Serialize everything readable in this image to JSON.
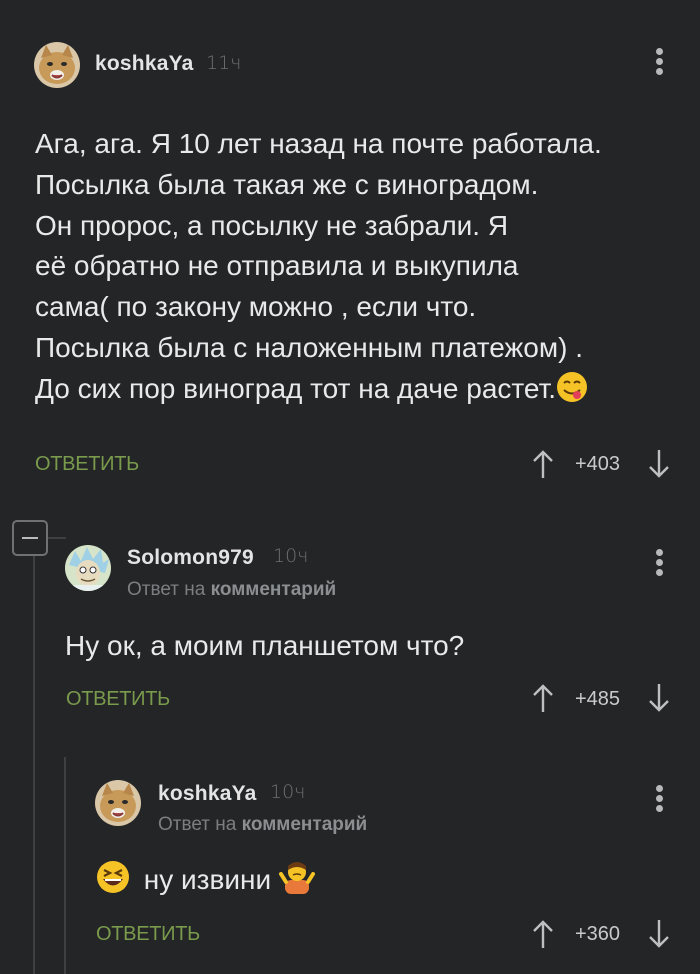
{
  "comments": [
    {
      "username": "koshkaYa",
      "time": "11ч",
      "lines": [
        "Ага, ага. Я 10 лет назад на почте работала.",
        "Посылка была такая же с виноградом.",
        "Он пророс, а посылку не забрали. Я",
        "её обратно не отправила и выкупила",
        "сама( по закону можно , если что.",
        "Посылка была с наложенным платежом) .",
        "До сих пор виноград тот на даче растет."
      ],
      "emoji": "yum-face-emoji",
      "reply_label": "ОТВЕТИТЬ",
      "score": "+403"
    },
    {
      "username": "Solomon979",
      "time": "10ч",
      "reply_prefix": "Ответ на",
      "reply_target": "комментарий",
      "text": "Ну ок, а моим планшетом что?",
      "reply_label": "ОТВЕТИТЬ",
      "score": "+485"
    },
    {
      "username": "koshkaYa",
      "time": "10ч",
      "reply_prefix": "Ответ на",
      "reply_target": "комментарий",
      "text": "ну извини",
      "emoji_before": "laughing-face-emoji",
      "emoji_after": "person-shrugging-emoji",
      "reply_label": "ОТВЕТИТЬ",
      "score": "+360"
    }
  ],
  "colors": {
    "background": "#232527",
    "reply_green": "#7a9a4c",
    "username": "#e4e4e4",
    "muted": "#6c6f72",
    "thread_line": "#3e4144"
  }
}
